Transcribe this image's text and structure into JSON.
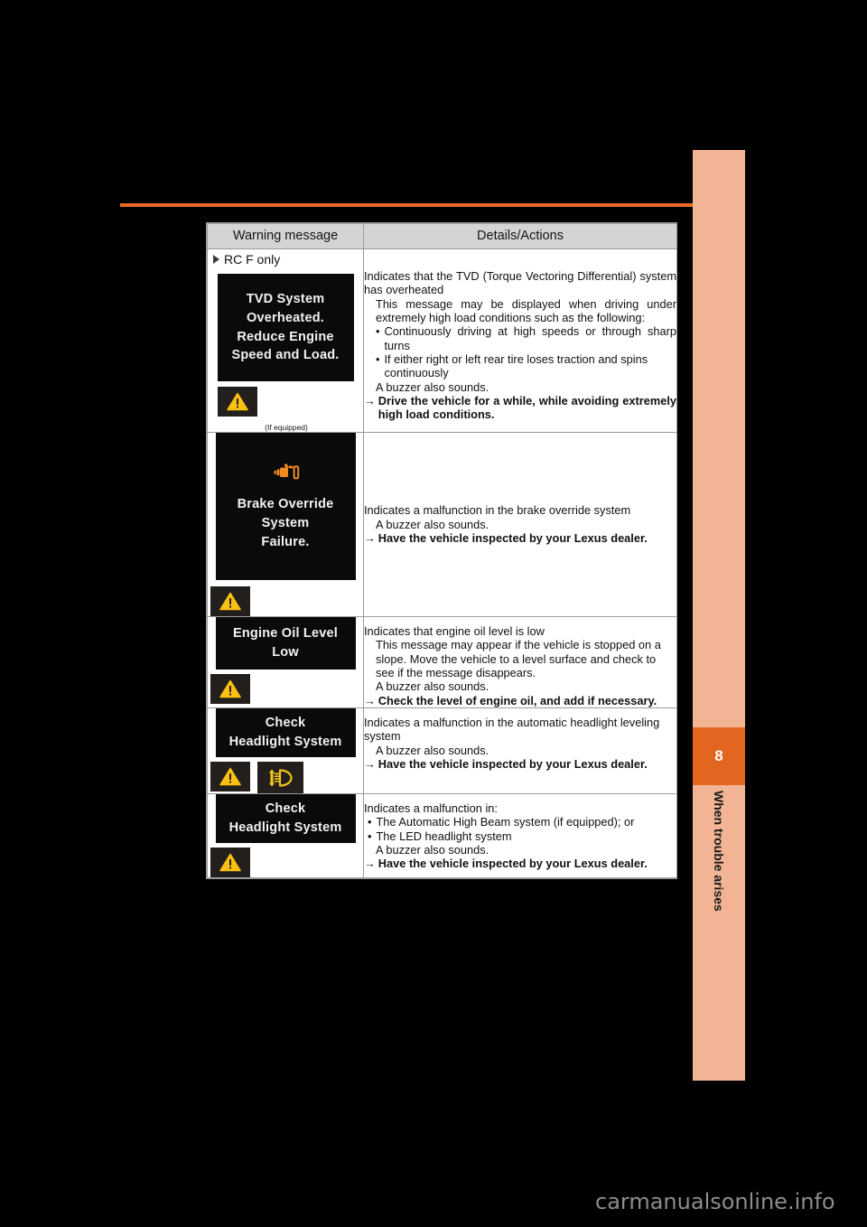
{
  "page": {
    "chapter_number": "8",
    "chapter_title": "When trouble arises",
    "watermark": "carmanualsonline.info",
    "accent_color": "#ea6a2a",
    "tab_color": "#f2b494",
    "tab_number_color": "#e2661f"
  },
  "table": {
    "headers": {
      "col1": "Warning message",
      "col2": "Details/Actions"
    },
    "rows": [
      {
        "note": "RC F only",
        "lcd_lines": [
          "TVD System",
          "Overheated.",
          "Reduce Engine",
          "Speed and Load."
        ],
        "icons": [
          "warning-triangle-icon"
        ],
        "caption": "(If equipped)",
        "details": {
          "intro": "Indicates that the TVD (Torque Vectoring Differential) system has overheated",
          "sub": "This message may be displayed when driving under extremely high load conditions such as the following:",
          "bullets": [
            "Continuously driving at high speeds or through sharp turns",
            "If either right or left rear tire loses traction and spins continuously"
          ],
          "buzzer": "A buzzer also sounds.",
          "action": "Drive the vehicle for a while, while avoiding extremely high load conditions."
        }
      },
      {
        "note": "",
        "lcd_lines": [
          "Brake Override",
          "System",
          "Failure."
        ],
        "lcd_icon": "brake-override-icon",
        "icons": [
          "warning-triangle-icon"
        ],
        "caption": "",
        "details": {
          "intro": "Indicates a malfunction in the brake override system",
          "sub": "",
          "bullets": [],
          "buzzer": "A buzzer also sounds.",
          "action": "Have the vehicle inspected by your Lexus dealer."
        }
      },
      {
        "note": "",
        "lcd_lines": [
          "Engine Oil Level",
          "Low"
        ],
        "icons": [
          "warning-triangle-icon"
        ],
        "caption": "",
        "details": {
          "intro": "Indicates that engine oil level is low",
          "sub": "This message may appear if the vehicle is stopped on a slope. Move the vehicle to a level surface and check to see if the message disappears.",
          "bullets": [],
          "buzzer": "A buzzer also sounds.",
          "action": "Check the level of engine oil, and add if necessary."
        }
      },
      {
        "note": "",
        "lcd_lines": [
          "Check",
          "Headlight System"
        ],
        "icons": [
          "warning-triangle-icon",
          "headlight-leveling-icon"
        ],
        "caption": "",
        "details": {
          "intro": "Indicates a malfunction in the automatic headlight leveling system",
          "sub": "",
          "bullets": [],
          "buzzer": "A buzzer also sounds.",
          "action": "Have the vehicle inspected by your Lexus dealer."
        }
      },
      {
        "note": "",
        "lcd_lines": [
          "Check",
          "Headlight System"
        ],
        "icons": [
          "warning-triangle-icon"
        ],
        "caption": "",
        "details": {
          "intro": "Indicates a malfunction in:",
          "sub": "",
          "bullets": [
            "The Automatic High Beam system (if equipped); or",
            "The LED headlight system"
          ],
          "buzzer": "A buzzer also sounds.",
          "action": "Have the vehicle inspected by your Lexus dealer."
        }
      }
    ]
  }
}
